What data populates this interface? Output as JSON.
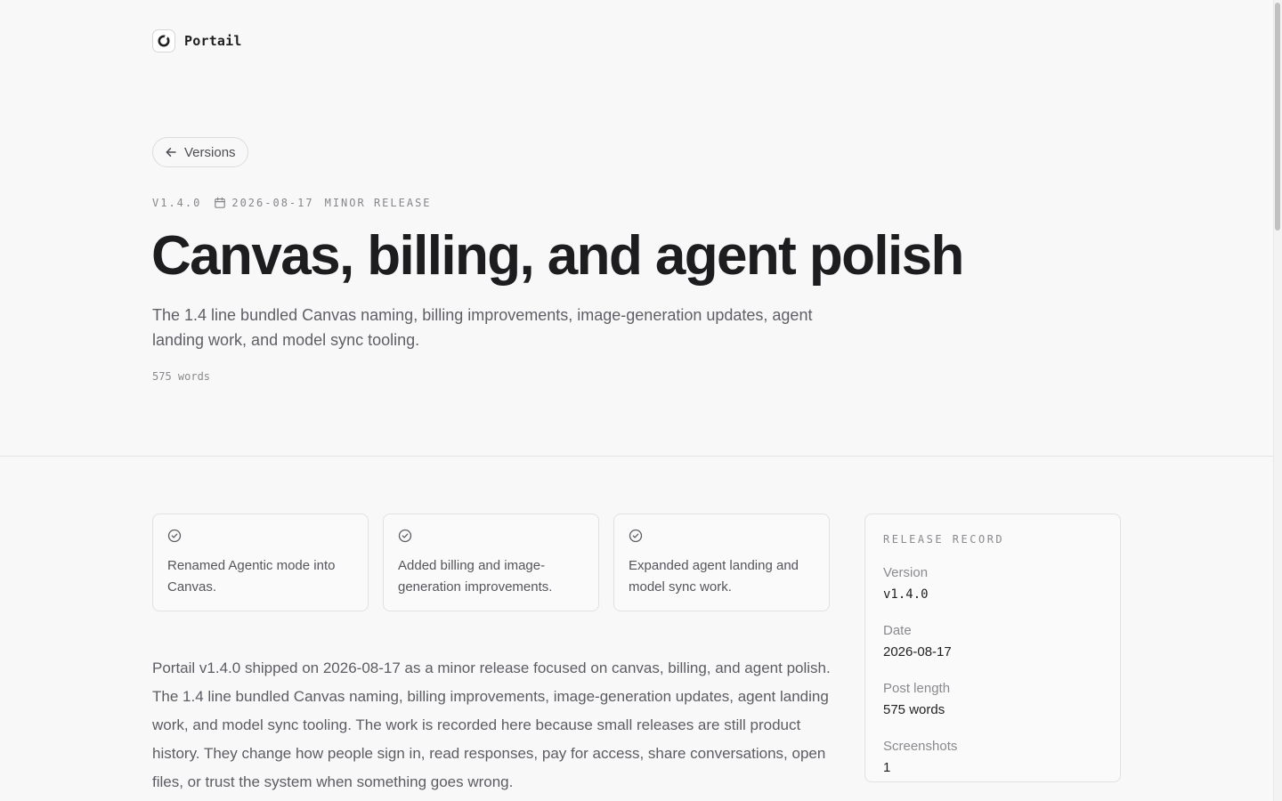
{
  "brand": {
    "name": "Portail"
  },
  "back_button": {
    "label": "Versions"
  },
  "meta": {
    "version": "V1.4.0",
    "date": "2026-08-17",
    "release_type": "MINOR RELEASE"
  },
  "title": "Canvas, billing, and agent polish",
  "summary": "The 1.4 line bundled Canvas naming, billing improvements, image-generation updates, agent landing work, and model sync tooling.",
  "word_count": "575 words",
  "highlights": [
    {
      "text": "Renamed Agentic mode into Canvas."
    },
    {
      "text": "Added billing and image-generation improvements."
    },
    {
      "text": "Expanded agent landing and model sync work."
    }
  ],
  "body": "Portail v1.4.0 shipped on 2026-08-17 as a minor release focused on canvas, billing, and agent polish. The 1.4 line bundled Canvas naming, billing improvements, image-generation updates, agent landing work, and model sync tooling. The work is recorded here because small releases are still product history. They change how people sign in, read responses, pay for access, share conversations, open files, or trust the system when something goes wrong.",
  "release_record": {
    "heading": "RELEASE RECORD",
    "rows": [
      {
        "label": "Version",
        "value": "v1.4.0"
      },
      {
        "label": "Date",
        "value": "2026-08-17"
      },
      {
        "label": "Post length",
        "value": "575 words"
      },
      {
        "label": "Screenshots",
        "value": "1"
      }
    ]
  },
  "icons": {
    "brand": "portail-logo-icon",
    "back": "arrow-left-icon",
    "date": "calendar-icon",
    "highlight": "check-circle-icon"
  }
}
